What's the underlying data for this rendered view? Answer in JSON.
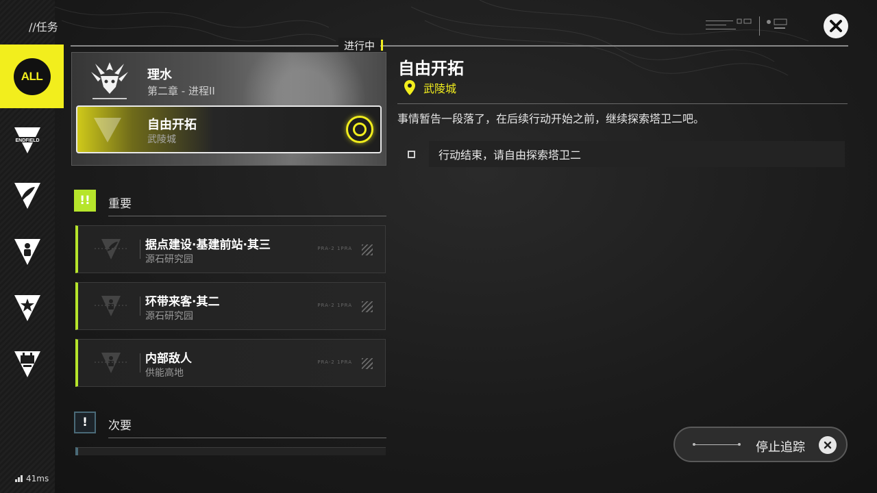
{
  "header": {
    "page_label": "//任务",
    "status_tag": "进行中"
  },
  "rail": {
    "all_label": "ALL",
    "items": [
      {
        "icon": "endfield-icon",
        "text": "ENDFIELD"
      },
      {
        "icon": "feather-icon"
      },
      {
        "icon": "person-icon"
      },
      {
        "icon": "star-icon"
      },
      {
        "icon": "building-icon"
      }
    ]
  },
  "main_quest": {
    "chapter_title": "理水",
    "chapter_sub": "第二章 - 进程II",
    "active": {
      "title": "自由开拓",
      "location": "武陵城"
    }
  },
  "sections": {
    "important": {
      "badge": "!!",
      "label": "重要"
    },
    "secondary": {
      "badge": "!",
      "label": "次要"
    }
  },
  "quests": [
    {
      "title": "据点建设·基建前站·其三",
      "location": "源石研究园",
      "code": "PRA-2 1PRA"
    },
    {
      "title": "环带来客·其二",
      "location": "源石研究园",
      "code": "PRA-2 1PRA"
    },
    {
      "title": "内部敌人",
      "location": "供能高地",
      "code": "PRA-2 1PRA"
    }
  ],
  "detail": {
    "title": "自由开拓",
    "location": "武陵城",
    "description": "事情暂告一段落了，在后续行动开始之前，继续探索塔卫二吧。",
    "objective": "行动结束，请自由探索塔卫二"
  },
  "stop_tracking": {
    "label": "停止追踪"
  },
  "ping": {
    "value": "41ms"
  },
  "colors": {
    "accent": "#f2ee1d",
    "important": "#b6e52b",
    "secondary": "#4a6a78"
  }
}
